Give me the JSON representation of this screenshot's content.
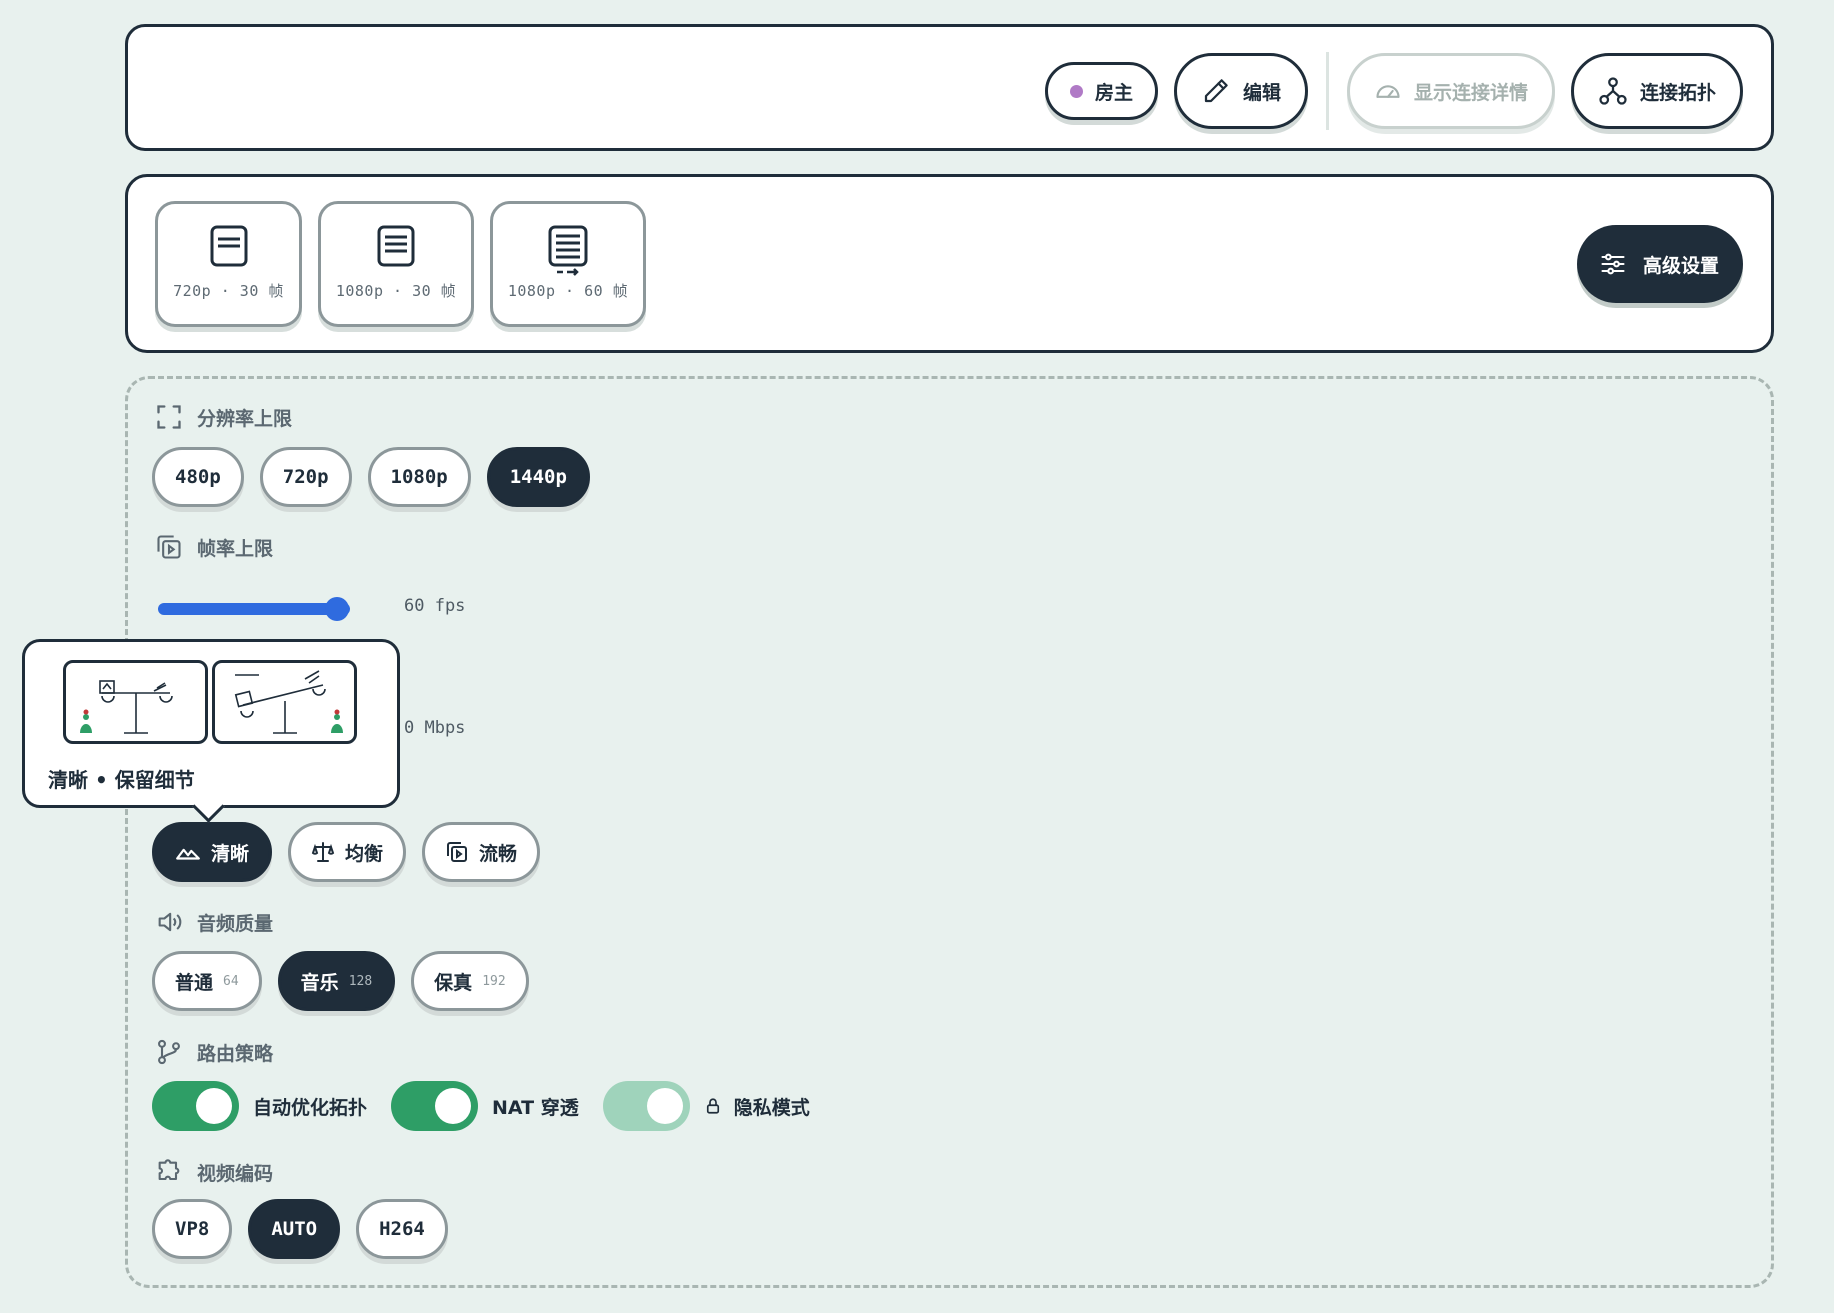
{
  "topbar": {
    "host_label": "房主",
    "edit_label": "编辑",
    "details_label": "显示连接详情",
    "topology_label": "连接拓扑"
  },
  "presets": {
    "items": [
      {
        "label": "720p · 30 帧",
        "icon": "document-icon"
      },
      {
        "label": "1080p · 30 帧",
        "icon": "document-icon"
      },
      {
        "label": "1080p · 60 帧",
        "icon": "document-forward-icon"
      }
    ],
    "advanced_label": "高级设置"
  },
  "settings": {
    "resolution": {
      "title": "分辨率上限",
      "options": [
        "480p",
        "720p",
        "1080p",
        "1440p"
      ],
      "selected": "1440p"
    },
    "framerate": {
      "title": "帧率上限",
      "value_text": "60 fps",
      "level": 1.0
    },
    "bitrate": {
      "value_text": "0 Mbps"
    },
    "mode": {
      "options": [
        "清晰",
        "均衡",
        "流畅"
      ],
      "selected": "清晰"
    },
    "audio": {
      "title": "音频质量",
      "options": [
        {
          "label": "普通",
          "sub": "64"
        },
        {
          "label": "音乐",
          "sub": "128"
        },
        {
          "label": "保真",
          "sub": "192"
        }
      ],
      "selected": "音乐"
    },
    "routing": {
      "title": "路由策略",
      "toggles": [
        {
          "label": "自动优化拓扑",
          "on": true
        },
        {
          "label": "NAT 穿透",
          "on": true
        },
        {
          "label": "隐私模式",
          "on": true,
          "disabled": true
        }
      ]
    },
    "codec": {
      "title": "视频编码",
      "options": [
        "VP8",
        "AUTO",
        "H264"
      ],
      "selected": "AUTO"
    }
  },
  "tooltip": {
    "text": "清晰 • 保留细节"
  },
  "colors": {
    "dark": "#1f2d3a",
    "accent_blue": "#2f6bdf",
    "toggle_green": "#2e9e66",
    "host_dot": "#b07ac6"
  }
}
